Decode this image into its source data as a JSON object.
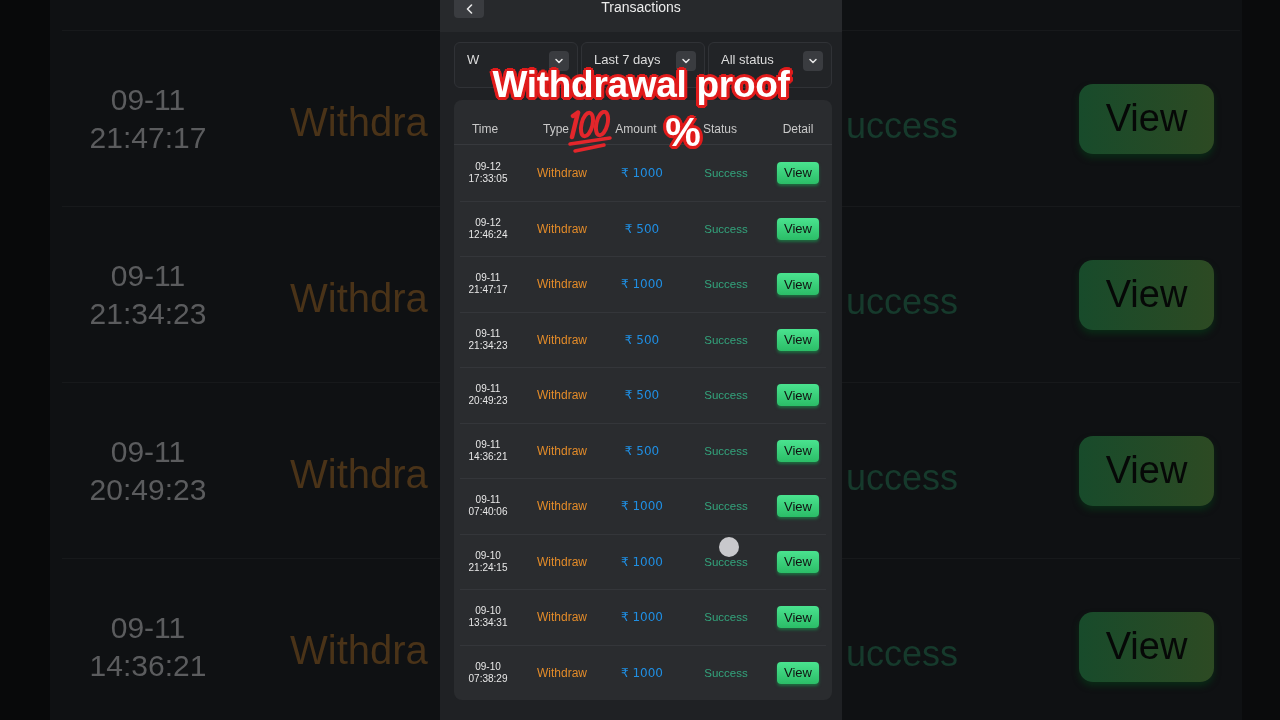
{
  "backdrop_left": {
    "rows": [
      {
        "date": "09-11",
        "clock": "21:47:17",
        "type": "Withdra"
      },
      {
        "date": "09-11",
        "clock": "21:34:23",
        "type": "Withdra"
      },
      {
        "date": "09-11",
        "clock": "20:49:23",
        "type": "Withdra"
      },
      {
        "date": "09-11",
        "clock": "14:36:21",
        "type": "Withdra"
      }
    ]
  },
  "header": {
    "title": "Transactions"
  },
  "filters": [
    {
      "label": "W"
    },
    {
      "label": "Last 7 days"
    },
    {
      "label": "All status"
    }
  ],
  "table": {
    "columns": [
      "Time",
      "Type",
      "Amount",
      "Status",
      "Detail"
    ],
    "rows": [
      {
        "date": "09-12",
        "clock": "17:33:05",
        "type": "Withdraw",
        "amount": "₹ 1000",
        "status": "Success",
        "action": "View"
      },
      {
        "date": "09-12",
        "clock": "12:46:24",
        "type": "Withdraw",
        "amount": "₹ 500",
        "status": "Success",
        "action": "View"
      },
      {
        "date": "09-11",
        "clock": "21:47:17",
        "type": "Withdraw",
        "amount": "₹ 1000",
        "status": "Success",
        "action": "View"
      },
      {
        "date": "09-11",
        "clock": "21:34:23",
        "type": "Withdraw",
        "amount": "₹ 500",
        "status": "Success",
        "action": "View"
      },
      {
        "date": "09-11",
        "clock": "20:49:23",
        "type": "Withdraw",
        "amount": "₹ 500",
        "status": "Success",
        "action": "View"
      },
      {
        "date": "09-11",
        "clock": "14:36:21",
        "type": "Withdraw",
        "amount": "₹ 500",
        "status": "Success",
        "action": "View"
      },
      {
        "date": "09-11",
        "clock": "07:40:06",
        "type": "Withdraw",
        "amount": "₹ 1000",
        "status": "Success",
        "action": "View"
      },
      {
        "date": "09-10",
        "clock": "21:24:15",
        "type": "Withdraw",
        "amount": "₹ 1000",
        "status": "Success",
        "action": "View"
      },
      {
        "date": "09-10",
        "clock": "13:34:31",
        "type": "Withdraw",
        "amount": "₹ 1000",
        "status": "Success",
        "action": "View"
      },
      {
        "date": "09-10",
        "clock": "07:38:29",
        "type": "Withdraw",
        "amount": "₹ 1000",
        "status": "Success",
        "action": "View"
      }
    ]
  },
  "caption": {
    "title": "Withdrawal proof",
    "suffix": "%"
  },
  "backdrop_right": {
    "rows": [
      {
        "status": "uccess",
        "action": "View"
      },
      {
        "status": "uccess",
        "action": "View"
      },
      {
        "status": "uccess",
        "action": "View"
      },
      {
        "status": "uccess",
        "action": "View"
      }
    ]
  }
}
